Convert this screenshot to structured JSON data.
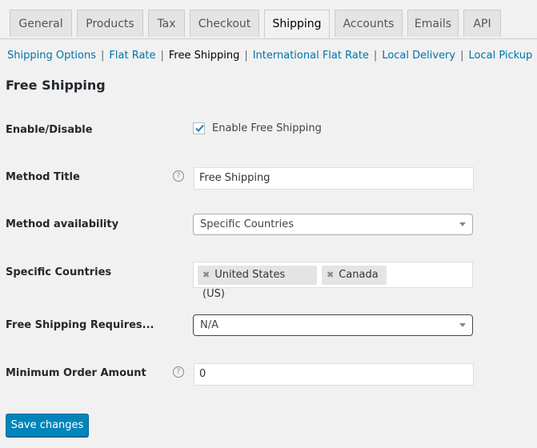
{
  "tabs": [
    {
      "label": "General",
      "active": false
    },
    {
      "label": "Products",
      "active": false
    },
    {
      "label": "Tax",
      "active": false
    },
    {
      "label": "Checkout",
      "active": false
    },
    {
      "label": "Shipping",
      "active": true
    },
    {
      "label": "Accounts",
      "active": false
    },
    {
      "label": "Emails",
      "active": false
    },
    {
      "label": "API",
      "active": false
    }
  ],
  "subnav": {
    "items": [
      {
        "label": "Shipping Options",
        "current": false
      },
      {
        "label": "Flat Rate",
        "current": false
      },
      {
        "label": "Free Shipping",
        "current": true
      },
      {
        "label": "International Flat Rate",
        "current": false
      },
      {
        "label": "Local Delivery",
        "current": false
      },
      {
        "label": "Local Pickup",
        "current": false
      }
    ],
    "separator": "|"
  },
  "page_title": "Free Shipping",
  "form": {
    "enable": {
      "label": "Enable/Disable",
      "checkbox_label": "Enable Free Shipping",
      "checked": true
    },
    "method_title": {
      "label": "Method Title",
      "value": "Free Shipping",
      "help": "?"
    },
    "availability": {
      "label": "Method availability",
      "value": "Specific Countries"
    },
    "countries": {
      "label": "Specific Countries",
      "selected": [
        "United States (US)",
        "Canada"
      ],
      "remove_glyph": "✖"
    },
    "requires": {
      "label": "Free Shipping Requires...",
      "value": "N/A"
    },
    "min_amount": {
      "label": "Minimum Order Amount",
      "value": "0",
      "help": "?"
    }
  },
  "save_button": "Save changes",
  "colors": {
    "link": "#0073aa",
    "primary_button": "#0085ba",
    "background": "#f1f1f1"
  }
}
